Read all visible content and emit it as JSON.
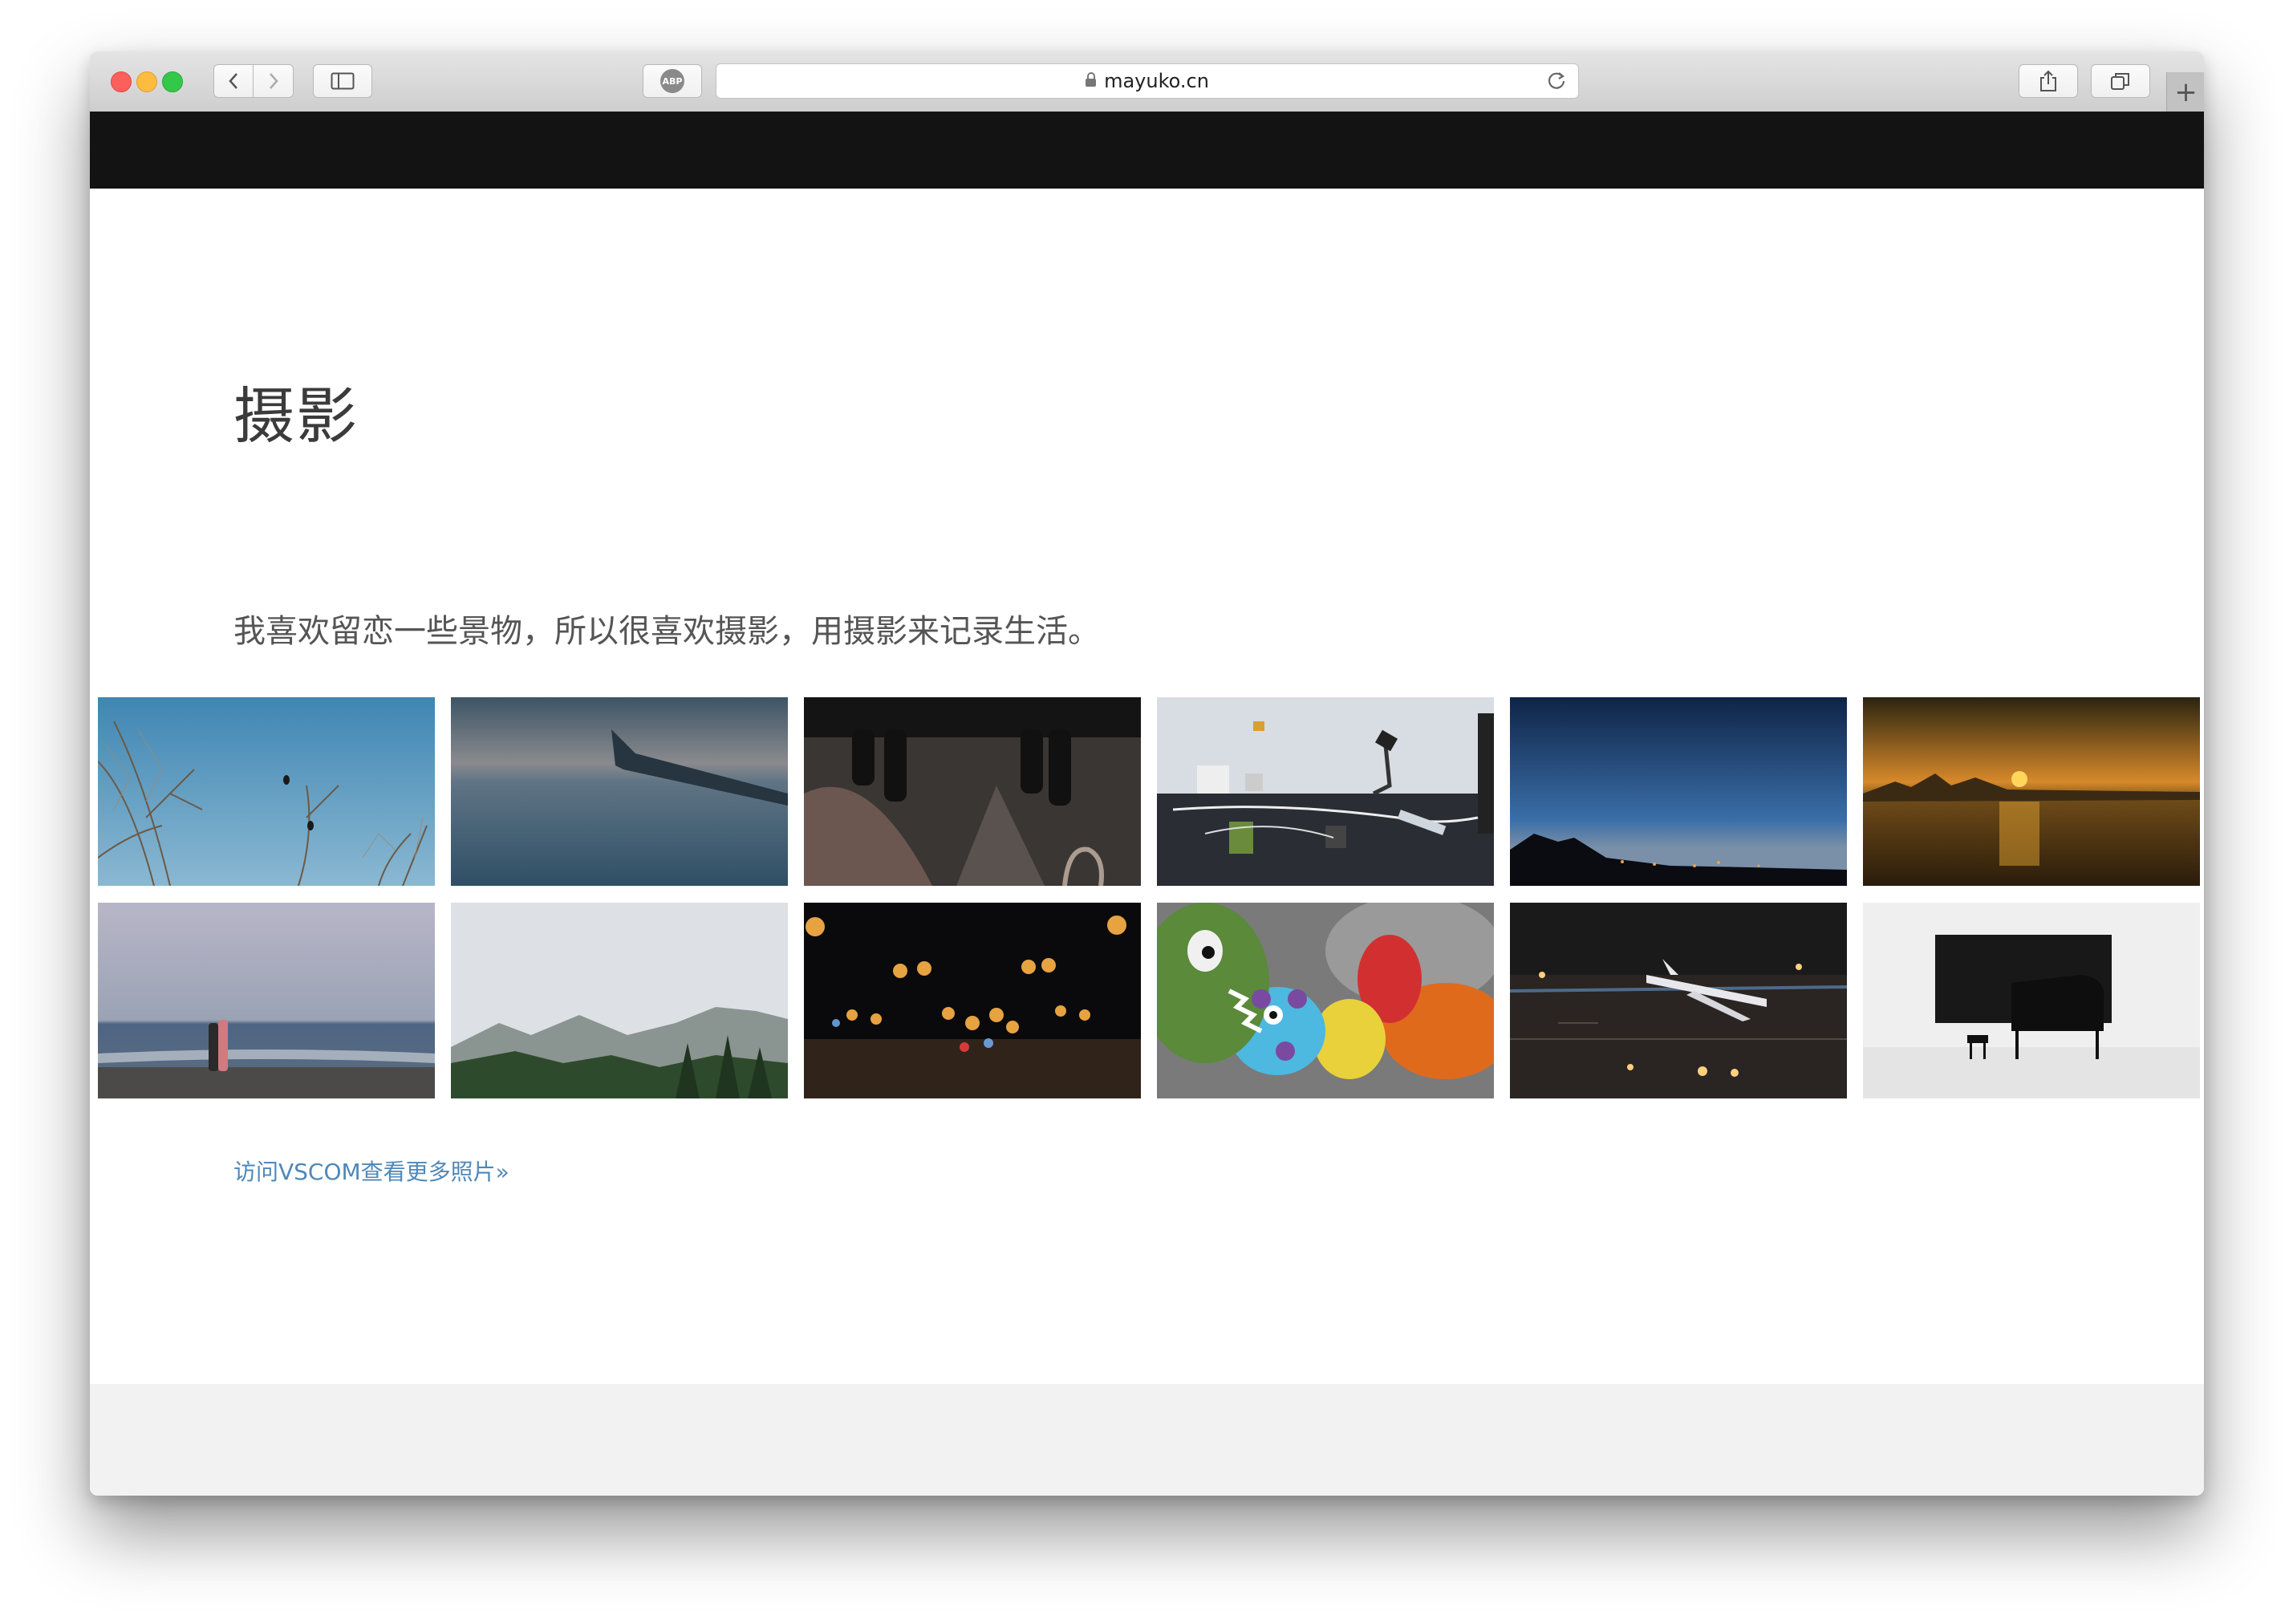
{
  "browser": {
    "url": "mayuko.cn",
    "abp_label": "ABP",
    "new_tab": "+"
  },
  "page": {
    "title": "摄影",
    "subtitle": "我喜欢留恋一些景物，所以很喜欢摄影，用摄影来记录生活。",
    "more_link": "访问VSCOM查看更多照片»"
  },
  "colors": {
    "nav_bar": "#131313",
    "link": "#4f88b8",
    "footer": "#f2f2f3"
  },
  "gallery": {
    "row1": [
      "birds-on-branches",
      "airplane-wing-over-clouds",
      "feet-over-ledge",
      "desk-electronics",
      "night-city-skyline",
      "sunset-over-water"
    ],
    "row2": [
      "couple-on-beach",
      "misty-mountains",
      "night-street-bokeh",
      "plush-dinosaur-toys",
      "airplane-at-night-apron",
      "piano-in-white-room"
    ]
  }
}
